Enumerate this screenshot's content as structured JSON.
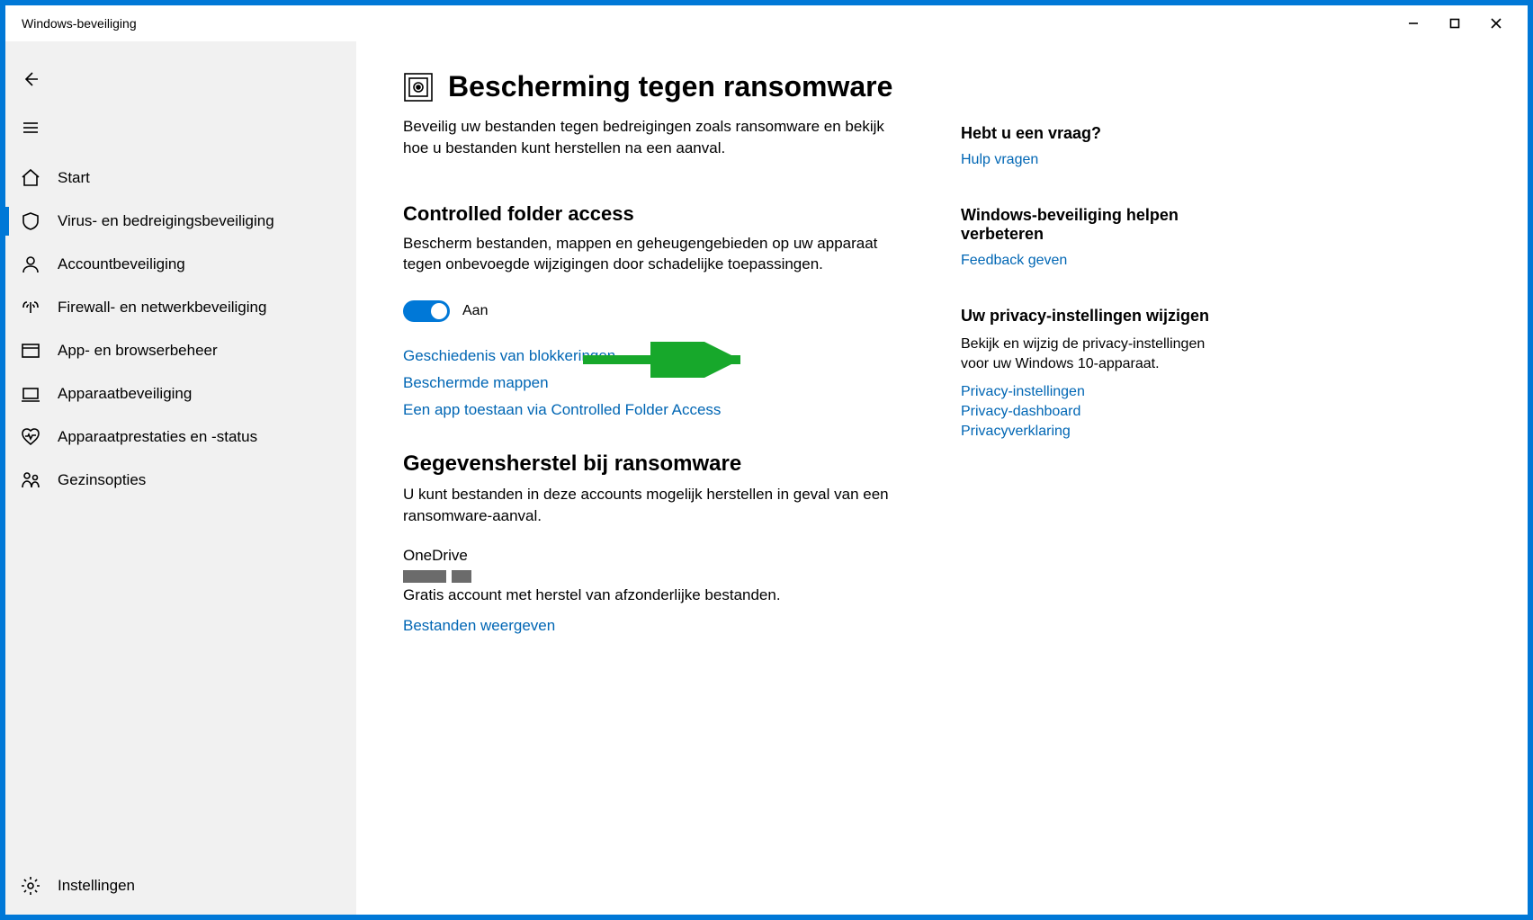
{
  "window": {
    "title": "Windows-beveiliging"
  },
  "sidebar": {
    "items": [
      {
        "id": "home",
        "label": "Start"
      },
      {
        "id": "virus",
        "label": "Virus- en bedreigingsbeveiliging"
      },
      {
        "id": "account",
        "label": "Accountbeveiliging"
      },
      {
        "id": "firewall",
        "label": "Firewall- en netwerkbeveiliging"
      },
      {
        "id": "appbrowser",
        "label": "App- en browserbeheer"
      },
      {
        "id": "device",
        "label": "Apparaatbeveiliging"
      },
      {
        "id": "perf",
        "label": "Apparaatprestaties en -status"
      },
      {
        "id": "family",
        "label": "Gezinsopties"
      }
    ],
    "settings_label": "Instellingen"
  },
  "page": {
    "title": "Bescherming tegen ransomware",
    "description": "Beveilig uw bestanden tegen bedreigingen zoals ransomware en bekijk hoe u bestanden kunt herstellen na een aanval."
  },
  "cfa": {
    "heading": "Controlled folder access",
    "description": "Bescherm bestanden, mappen en geheugengebieden op uw apparaat tegen onbevoegde wijzigingen door schadelijke toepassingen.",
    "toggle_state_label": "Aan",
    "links": {
      "history": "Geschiedenis van blokkeringen",
      "protected": "Beschermde mappen",
      "allow": "Een app toestaan via Controlled Folder Access"
    }
  },
  "recovery": {
    "heading": "Gegevensherstel bij ransomware",
    "description": "U kunt bestanden in deze accounts mogelijk herstellen in geval van een ransomware-aanval.",
    "onedrive_label": "OneDrive",
    "onedrive_desc": "Gratis account met herstel van afzonderlijke bestanden.",
    "view_files": "Bestanden weergeven"
  },
  "aside": {
    "question": {
      "heading": "Hebt u een vraag?",
      "link": "Hulp vragen"
    },
    "improve": {
      "heading": "Windows-beveiliging helpen verbeteren",
      "link": "Feedback geven"
    },
    "privacy": {
      "heading": "Uw privacy-instellingen wijzigen",
      "desc": "Bekijk en wijzig de privacy-instellingen voor uw Windows 10-apparaat.",
      "links": {
        "settings": "Privacy-instellingen",
        "dashboard": "Privacy-dashboard",
        "statement": "Privacyverklaring"
      }
    }
  }
}
